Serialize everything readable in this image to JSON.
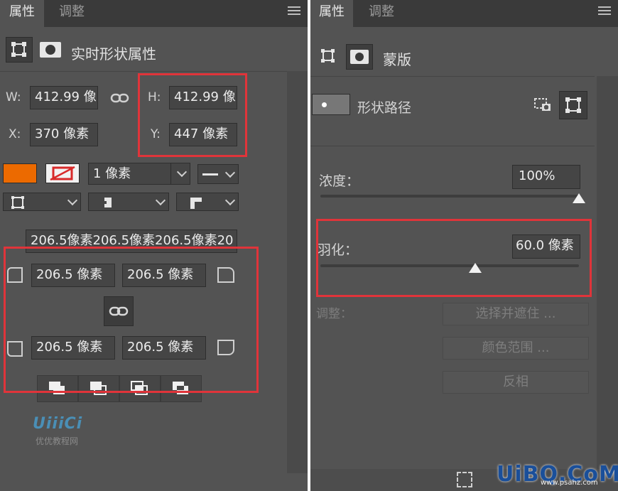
{
  "left": {
    "tabs": [
      "属性",
      "调整"
    ],
    "header_title": "实时形状属性",
    "w_label": "W:",
    "w_value": "412.99 像",
    "h_label": "H:",
    "h_value": "412.99 像",
    "x_label": "X:",
    "x_value": "370 像素",
    "y_label": "Y:",
    "y_value": "447 像素",
    "fill_color": "#ec6a00",
    "stroke_width": "1 像素",
    "corners_combined": "206.5像素206.5像素206.5像素20",
    "corner_tl": "206.5 像素",
    "corner_tr": "206.5 像素",
    "corner_bl": "206.5 像素",
    "corner_br": "206.5 像素",
    "watermark_logo": "UiiiCi",
    "watermark_text": "优优教程网"
  },
  "right": {
    "tabs": [
      "属性",
      "调整"
    ],
    "header_title": "蒙版",
    "path_label": "形状路径",
    "density_label": "浓度：",
    "density_value": "100%",
    "density_fraction": 1.0,
    "feather_label": "羽化：",
    "feather_value": "60.0 像素",
    "feather_fraction": 0.6,
    "adjust_label": "调整：",
    "btn_select_mask": "选择并遮住 ...",
    "btn_color_range": "颜色范围 ...",
    "btn_invert": "反相",
    "watermark": "UiBQ.CoM",
    "watermark_sub": "www.psahz.com"
  },
  "colors": {
    "highlight": "#e0343a"
  }
}
